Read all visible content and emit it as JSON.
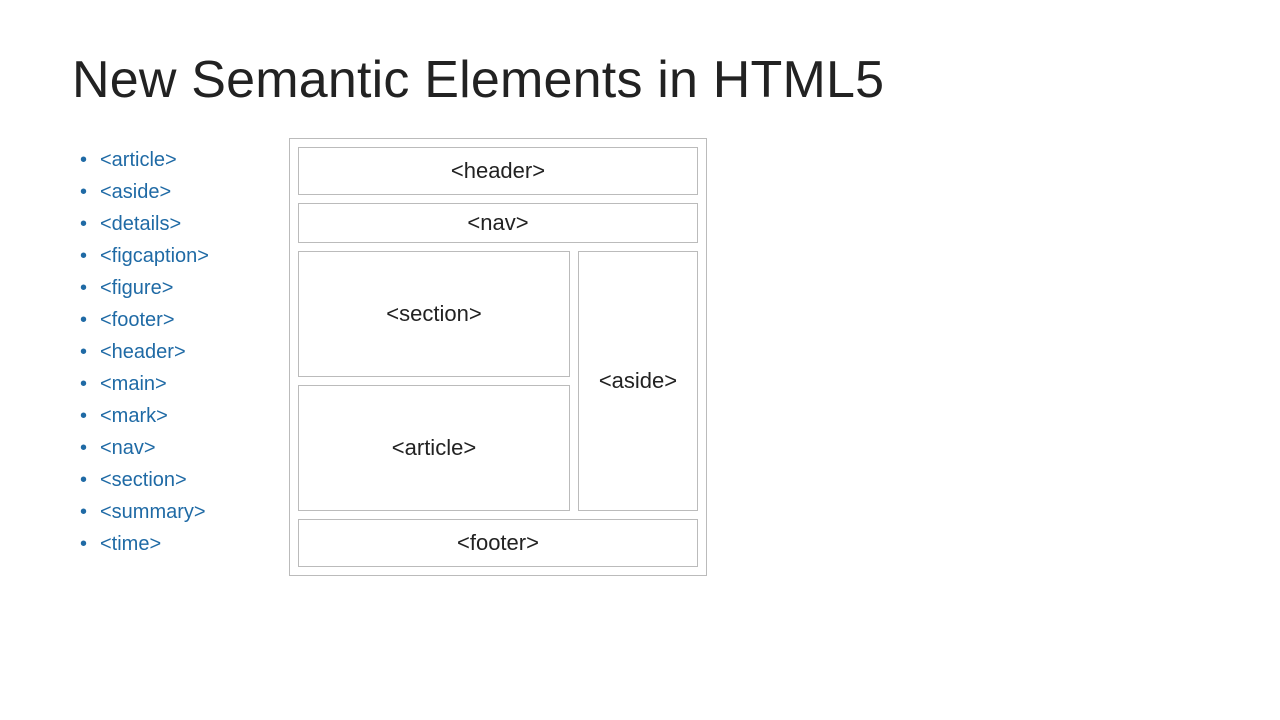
{
  "title": "New Semantic Elements in HTML5",
  "bullets": [
    "<article>",
    "<aside>",
    "<details>",
    "<figcaption>",
    "<figure>",
    "<footer>",
    "<header>",
    "<main>",
    "<mark>",
    "<nav>",
    "<section>",
    "<summary>",
    "<time>"
  ],
  "diagram": {
    "header": "<header>",
    "nav": "<nav>",
    "section": "<section>",
    "article": "<article>",
    "aside": "<aside>",
    "footer": "<footer>"
  }
}
